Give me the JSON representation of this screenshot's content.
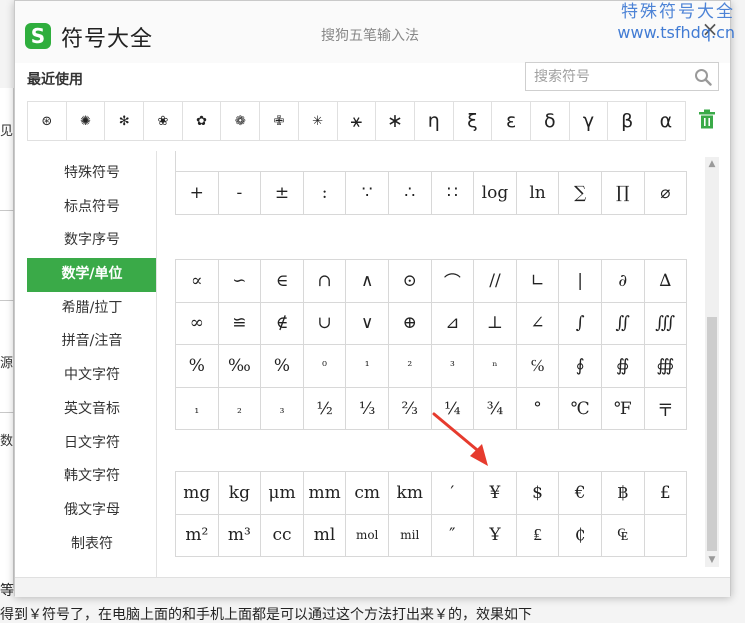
{
  "watermark": {
    "line1": "特殊符号大全",
    "line2": "www.tsfhdq.cn"
  },
  "dialog": {
    "title": "符号大全",
    "app_name": "搜狗五笔输入法",
    "logo_letter": "S",
    "close_glyph": "×"
  },
  "recent": {
    "label": "最近使用",
    "symbols": [
      "⊛",
      "✺",
      "✻",
      "❀",
      "✿",
      "❁",
      "✙",
      "✳",
      "⚹",
      "∗",
      "η",
      "ξ",
      "ε",
      "δ",
      "γ",
      "β",
      "α"
    ]
  },
  "search": {
    "placeholder": "搜索符号"
  },
  "sidebar": {
    "items": [
      "特殊符号",
      "标点符号",
      "数字序号",
      "数学/单位",
      "希腊/拉丁",
      "拼音/注音",
      "中文字符",
      "英文音标",
      "日文字符",
      "韩文字符",
      "俄文字母",
      "制表符"
    ],
    "active_index": 3
  },
  "grid1": [
    "+",
    "-",
    "±",
    ":",
    "∵",
    "∴",
    "∷",
    "log",
    "ln",
    "∑",
    "∏",
    "⌀"
  ],
  "grid2": [
    "∝",
    "∽",
    "∈",
    "∩",
    "∧",
    "⊙",
    "⌒",
    "//",
    "∟",
    "|",
    "∂",
    "∆",
    "∞",
    "≌",
    "∉",
    "∪",
    "∨",
    "⊕",
    "⊿",
    "⊥",
    "∠",
    "∫",
    "∬",
    "∭",
    "%",
    "‰",
    "%",
    "⁰",
    "¹",
    "²",
    "³",
    "ⁿ",
    "℅",
    "∮",
    "∯",
    "∰",
    "₁",
    "₂",
    "₃",
    "½",
    "⅓",
    "⅔",
    "¼",
    "¾",
    "°",
    "℃",
    "℉",
    "〒"
  ],
  "grid3": [
    "mg",
    "kg",
    "μm",
    "mm",
    "cm",
    "km",
    "′",
    "¥",
    "$",
    "€",
    "฿",
    "£",
    "m²",
    "m³",
    "cc",
    "ml",
    "mol",
    "mil",
    "″",
    "Ұ",
    "₤",
    "₵",
    "₠",
    ""
  ],
  "background": {
    "bottom_line": "得到￥符号了，在电脑上面的和手机上面都是可以通过这个方法打出来￥的，效果如下",
    "deng": "等",
    "left_chars": [
      "见",
      "源",
      "数"
    ]
  },
  "colors": {
    "accent": "#3aaa48",
    "watermark": "#2f6fd0",
    "arrow": "#e63b2e"
  }
}
